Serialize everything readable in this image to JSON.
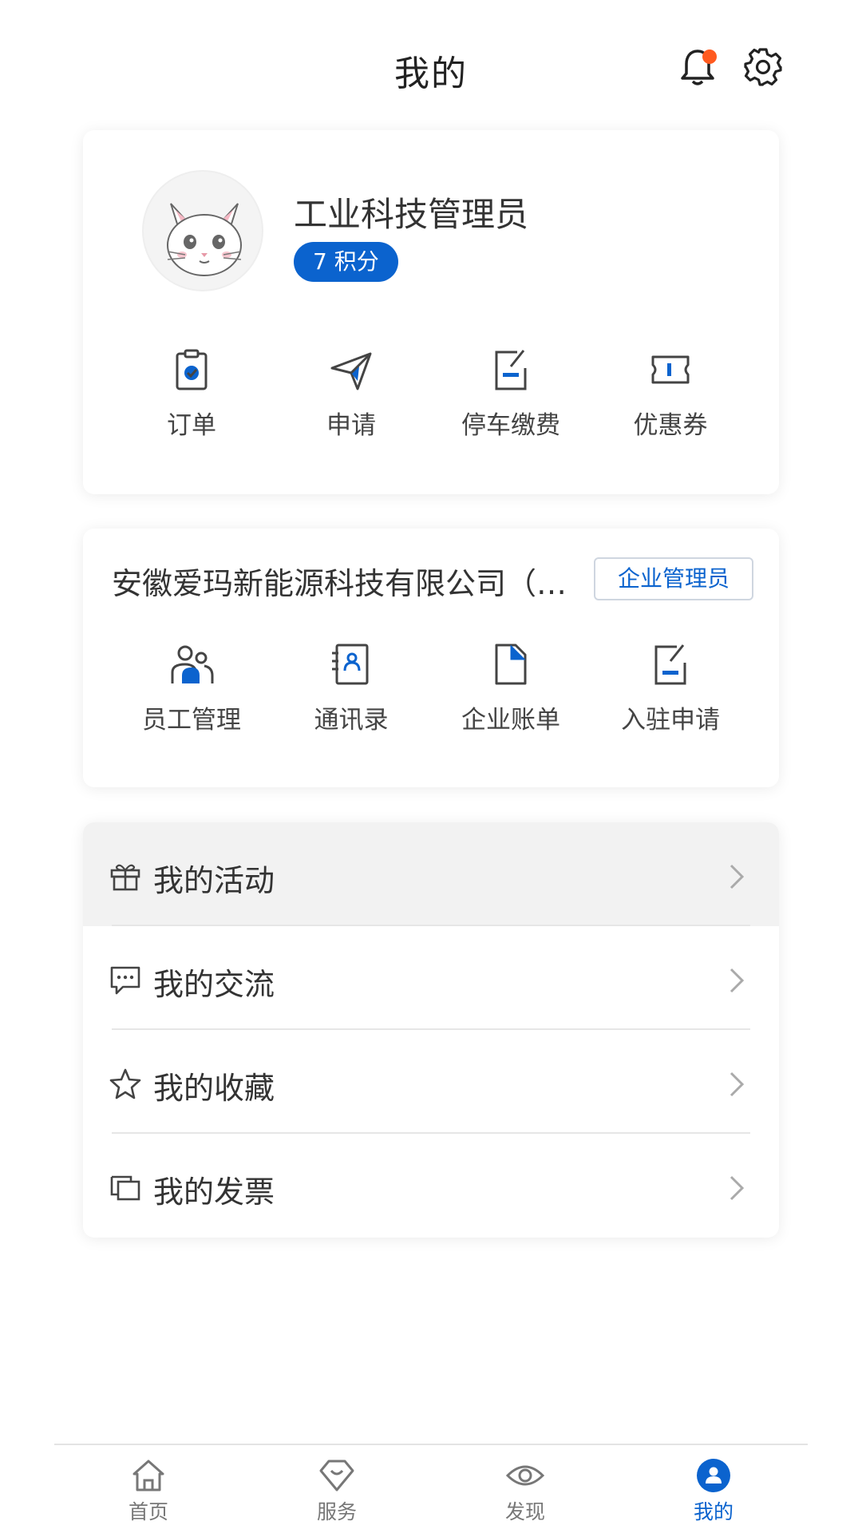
{
  "header": {
    "title": "我的"
  },
  "profile": {
    "user_name": "工业科技管理员",
    "points_label": "7 积分",
    "shortcuts": [
      {
        "label": "订单",
        "icon": "order-icon"
      },
      {
        "label": "申请",
        "icon": "apply-icon"
      },
      {
        "label": "停车缴费",
        "icon": "parking-fee-icon"
      },
      {
        "label": "优惠券",
        "icon": "coupon-icon"
      }
    ]
  },
  "company": {
    "name": "安徽爱玛新能源科技有限公司（…",
    "role_badge": "企业管理员",
    "shortcuts": [
      {
        "label": "员工管理",
        "icon": "staff-icon"
      },
      {
        "label": "通讯录",
        "icon": "contacts-icon"
      },
      {
        "label": "企业账单",
        "icon": "bill-icon"
      },
      {
        "label": "入驻申请",
        "icon": "settle-apply-icon"
      }
    ]
  },
  "menu": [
    {
      "label": "我的活动",
      "icon": "gift-icon"
    },
    {
      "label": "我的交流",
      "icon": "chat-icon"
    },
    {
      "label": "我的收藏",
      "icon": "star-icon"
    },
    {
      "label": "我的发票",
      "icon": "invoice-icon"
    }
  ],
  "tabbar": [
    {
      "label": "首页",
      "icon": "home-icon"
    },
    {
      "label": "服务",
      "icon": "service-icon"
    },
    {
      "label": "发现",
      "icon": "eye-icon"
    },
    {
      "label": "我的",
      "icon": "user-icon"
    }
  ],
  "colors": {
    "accent": "#0b63ce",
    "notification_dot": "#ff5a1f"
  }
}
